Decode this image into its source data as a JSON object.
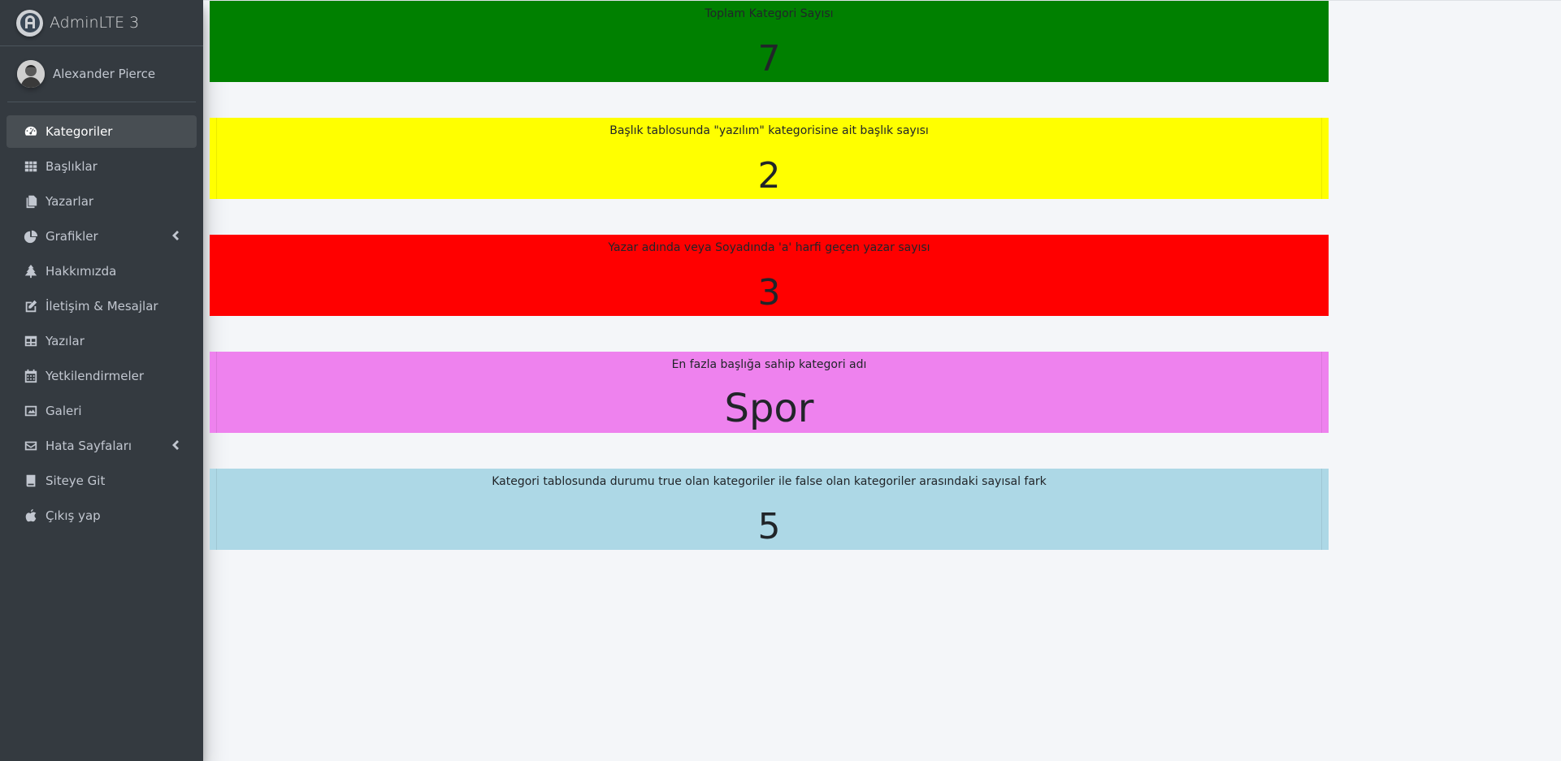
{
  "brand": {
    "name": "AdminLTE 3"
  },
  "user": {
    "name": "Alexander Pierce"
  },
  "sidebar": {
    "items": [
      {
        "label": "Kategoriler",
        "icon": "dashboard-gauge-icon",
        "active": true
      },
      {
        "label": "Başlıklar",
        "icon": "grid-table-icon"
      },
      {
        "label": "Yazarlar",
        "icon": "copy-documents-icon"
      },
      {
        "label": "Grafikler",
        "icon": "pie-chart-icon",
        "has_arrow": true
      },
      {
        "label": "Hakkımızda",
        "icon": "tree-icon"
      },
      {
        "label": "İletişim & Mesajlar",
        "icon": "edit-icon"
      },
      {
        "label": "Yazılar",
        "icon": "table-icon"
      },
      {
        "label": "Yetkilendirmeler",
        "icon": "calendar-icon"
      },
      {
        "label": "Galeri",
        "icon": "image-icon"
      },
      {
        "label": "Hata Sayfaları",
        "icon": "envelope-icon",
        "has_arrow": true
      },
      {
        "label": "Siteye Git",
        "icon": "book-icon"
      },
      {
        "label": "Çıkış yap",
        "icon": "apple-icon"
      }
    ]
  },
  "stats": [
    {
      "title": "Toplam Kategori Sayısı",
      "value": "7",
      "color": "#008000"
    },
    {
      "title": "Başlık tablosunda \"yazılım\" kategorisine ait başlık sayısı",
      "value": "2",
      "color": "#ffff00"
    },
    {
      "title": "Yazar adında veya Soyadında 'a' harfi geçen yazar sayısı",
      "value": "3",
      "color": "#ff0000"
    },
    {
      "title": "En fazla başlığa sahip kategori adı",
      "value": "Spor",
      "color": "#ee82ee"
    },
    {
      "title": "Kategori tablosunda durumu true olan kategoriler ile false olan kategoriler arasındaki sayısal fark",
      "value": "5",
      "color": "#add8e6"
    }
  ],
  "colors": {
    "sidebar_bg": "#343a40",
    "content_bg": "#f4f6f9"
  }
}
